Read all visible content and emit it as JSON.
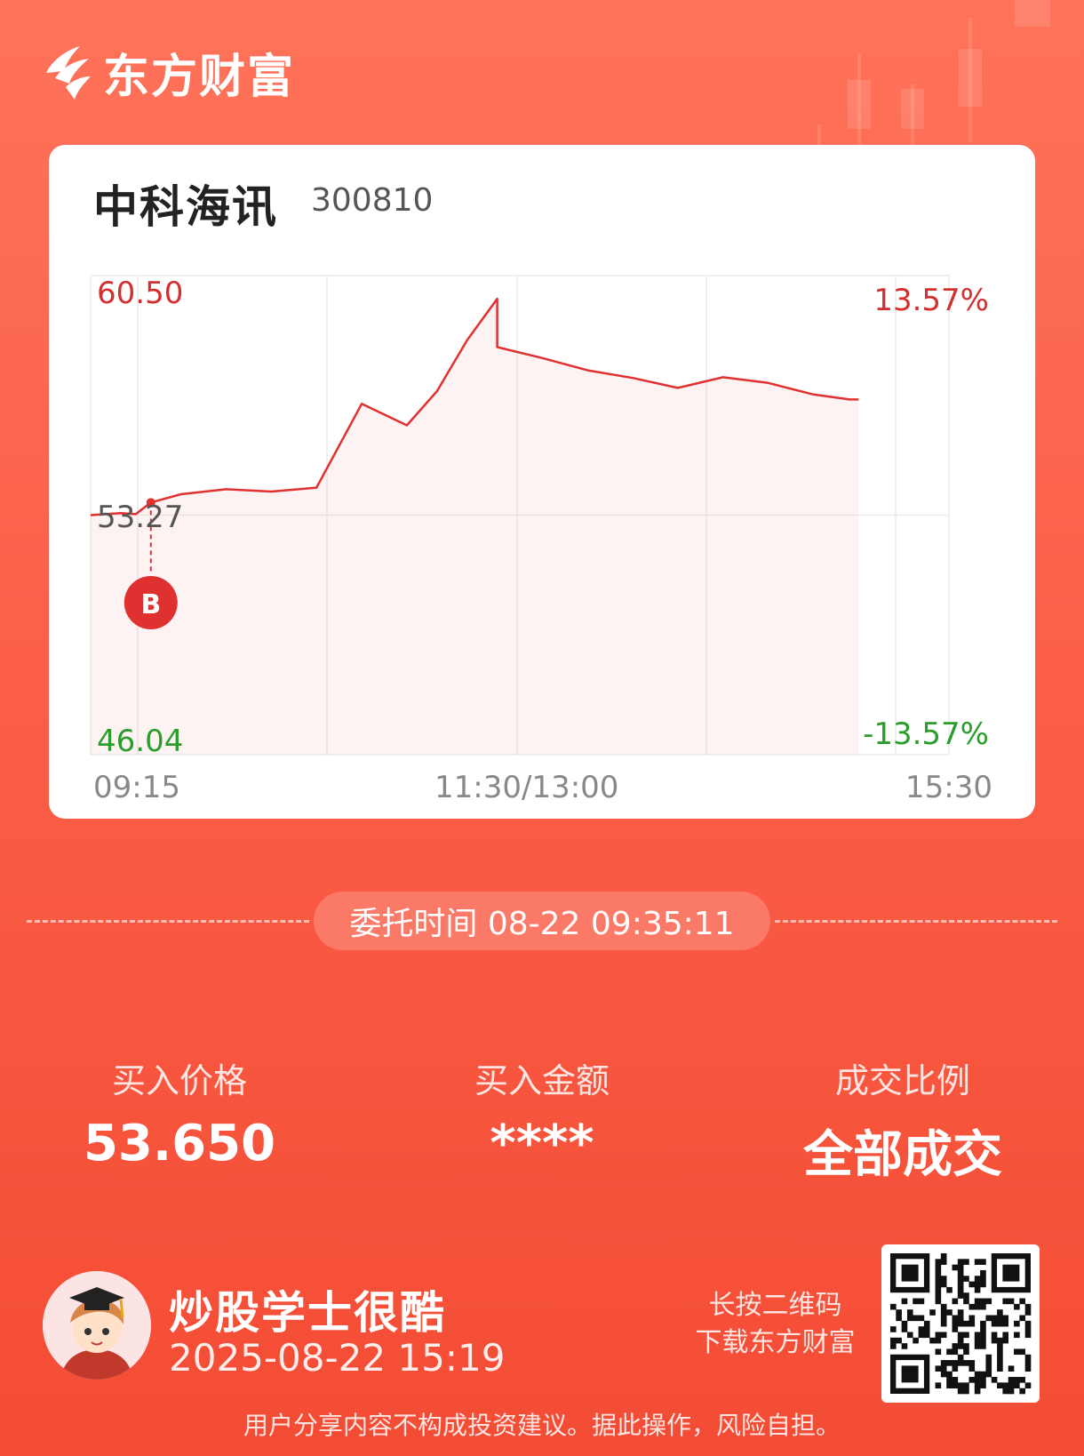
{
  "brand": {
    "name": "东方财富"
  },
  "stock": {
    "name": "中科海讯",
    "code": "300810"
  },
  "chart_data": {
    "type": "line",
    "price_max": 60.5,
    "price_min": 46.04,
    "prev_close": 53.27,
    "pct_max": "13.57%",
    "pct_min": "-13.57%",
    "price_max_label": "60.50",
    "price_min_label": "46.04",
    "prev_close_label": "53.27",
    "x_ticks": [
      "09:15",
      "11:30/13:00",
      "15:30"
    ],
    "buy_marker": "B",
    "series": [
      {
        "x": [
          "09:15",
          "09:25",
          "09:30",
          "09:35",
          "09:45",
          "10:00",
          "10:15",
          "10:30",
          "10:45",
          "11:00",
          "11:10",
          "11:20",
          "11:30",
          "13:00",
          "13:15",
          "13:30",
          "13:45",
          "14:00",
          "14:15",
          "14:30",
          "14:45",
          "14:57",
          "15:00",
          "15:30"
        ],
        "y": [
          53.27,
          53.33,
          53.3,
          53.65,
          53.9,
          54.05,
          53.98,
          54.1,
          56.63,
          55.98,
          57.01,
          58.55,
          59.8,
          58.34,
          58.01,
          57.64,
          57.41,
          57.11,
          57.43,
          57.26,
          56.91,
          56.76,
          56.76,
          56.76
        ]
      }
    ]
  },
  "order": {
    "time_text": "委托时间 08-22 09:35:11"
  },
  "stats": [
    {
      "label": "买入价格",
      "value": "53.650"
    },
    {
      "label": "买入金额",
      "value": "****"
    },
    {
      "label": "成交比例",
      "value": "全部成交"
    }
  ],
  "user": {
    "name": "炒股学士很酷",
    "share_time": "2025-08-22 15:19"
  },
  "qr": {
    "hint_line1": "长按二维码",
    "hint_line2": "下载东方财富"
  },
  "disclaimer": "用户分享内容不构成投资建议。据此操作，风险自担。",
  "colors": {
    "up": "#e03131",
    "down": "#2a9d2a",
    "accent": "#f44c34"
  }
}
